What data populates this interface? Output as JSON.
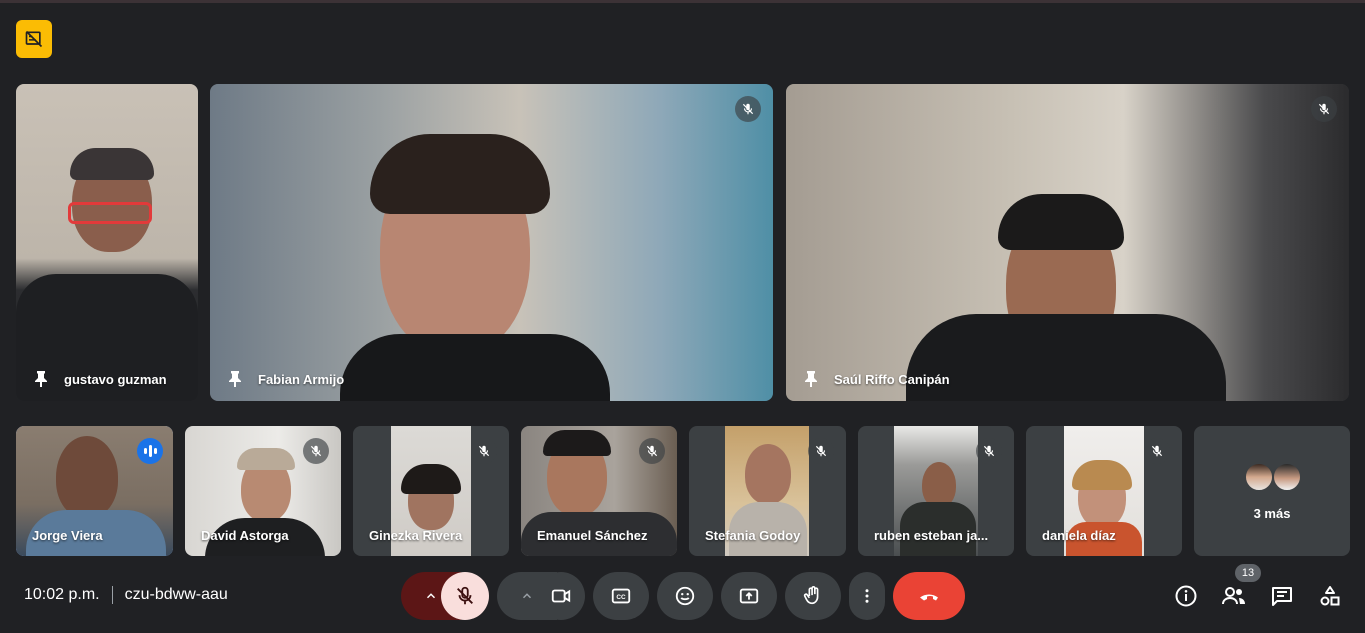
{
  "meeting": {
    "time": "10:02 p.m.",
    "code": "czu-bdww-aau",
    "participant_count": "13",
    "more_label": "3 más"
  },
  "main_tiles": [
    {
      "name": "gustavo guzman",
      "pinned": true,
      "muted": false
    },
    {
      "name": "Fabian Armijo",
      "pinned": true,
      "muted": true
    },
    {
      "name": "Saúl Riffo Canipán",
      "pinned": true,
      "muted": true
    }
  ],
  "small_tiles": [
    {
      "name": "Jorge Viera",
      "speaking": true,
      "muted": false
    },
    {
      "name": "David Astorga",
      "speaking": false,
      "muted": true
    },
    {
      "name": "Ginezka Rivera",
      "speaking": false,
      "muted": true
    },
    {
      "name": "Emanuel Sánchez",
      "speaking": false,
      "muted": true
    },
    {
      "name": "Stefania Godoy",
      "speaking": false,
      "muted": true
    },
    {
      "name": "ruben esteban ja...",
      "speaking": false,
      "muted": true
    },
    {
      "name": "daniela díaz",
      "speaking": false,
      "muted": true
    }
  ],
  "controls": {
    "audio_options": "chevron-up-icon",
    "mic": "mic-off-icon",
    "video_options": "chevron-up-icon",
    "camera": "videocam-icon",
    "captions": "closed-caption-icon",
    "reactions": "emoji-icon",
    "present": "present-screen-icon",
    "raise_hand": "hand-icon",
    "more_options": "more-vert-icon",
    "leave": "call-end-icon",
    "info": "info-icon",
    "people": "people-icon",
    "chat": "chat-icon",
    "activities": "activities-icon"
  },
  "colors": {
    "background": "#202124",
    "tile": "#3c4043",
    "badge": "#fbbc04",
    "speaking": "#8ab4f8",
    "end_call": "#ea4335",
    "mic_off_bg": "#f9dedc"
  }
}
